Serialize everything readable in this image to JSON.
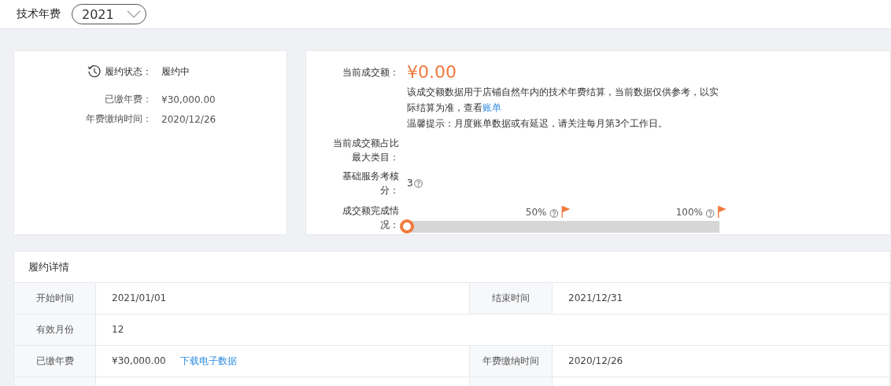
{
  "header": {
    "title": "技术年费",
    "year_select": {
      "value": "2021"
    }
  },
  "status_card": {
    "fields": [
      {
        "kind": "status",
        "label": "履约状态：",
        "value": "履约中"
      },
      {
        "kind": "plain",
        "label": "已缴年费：",
        "value": "¥30,000.00"
      },
      {
        "kind": "plain",
        "label": "年费缴纳时间：",
        "value": "2020/12/26"
      }
    ]
  },
  "turnover_card": {
    "amount_label": "当前成交额：",
    "amount": "¥0.00",
    "note": "该成交额数据用于店铺自然年内的技术年费结算，当前数据仅供参考，以实际结算为准，查看",
    "note_link": "账单",
    "tip": "温馨提示：月度账单数据或有延迟，请关注每月第3个工作日。",
    "top_category_label": "当前成交额占比最大类目：",
    "score_label": "基础服务考核分：",
    "score": "3",
    "progress_label": "成交额完成情况：",
    "progress": {
      "level": 0,
      "milestones": [
        {
          "label": "50%"
        },
        {
          "label": "100%"
        }
      ]
    }
  },
  "details": {
    "title": "履约详情",
    "rows": [
      [
        {
          "label": "开始时间",
          "value": "2021/01/01"
        },
        {
          "label": "结束时间",
          "value": "2021/12/31"
        }
      ],
      [
        {
          "label": "有效月份",
          "value": "12"
        }
      ],
      [
        {
          "label": "已缴年费",
          "value": "¥30,000.00",
          "link": "下载电子数据"
        },
        {
          "label": "年费缴纳时间",
          "value": "2020/12/26"
        }
      ]
    ]
  }
}
